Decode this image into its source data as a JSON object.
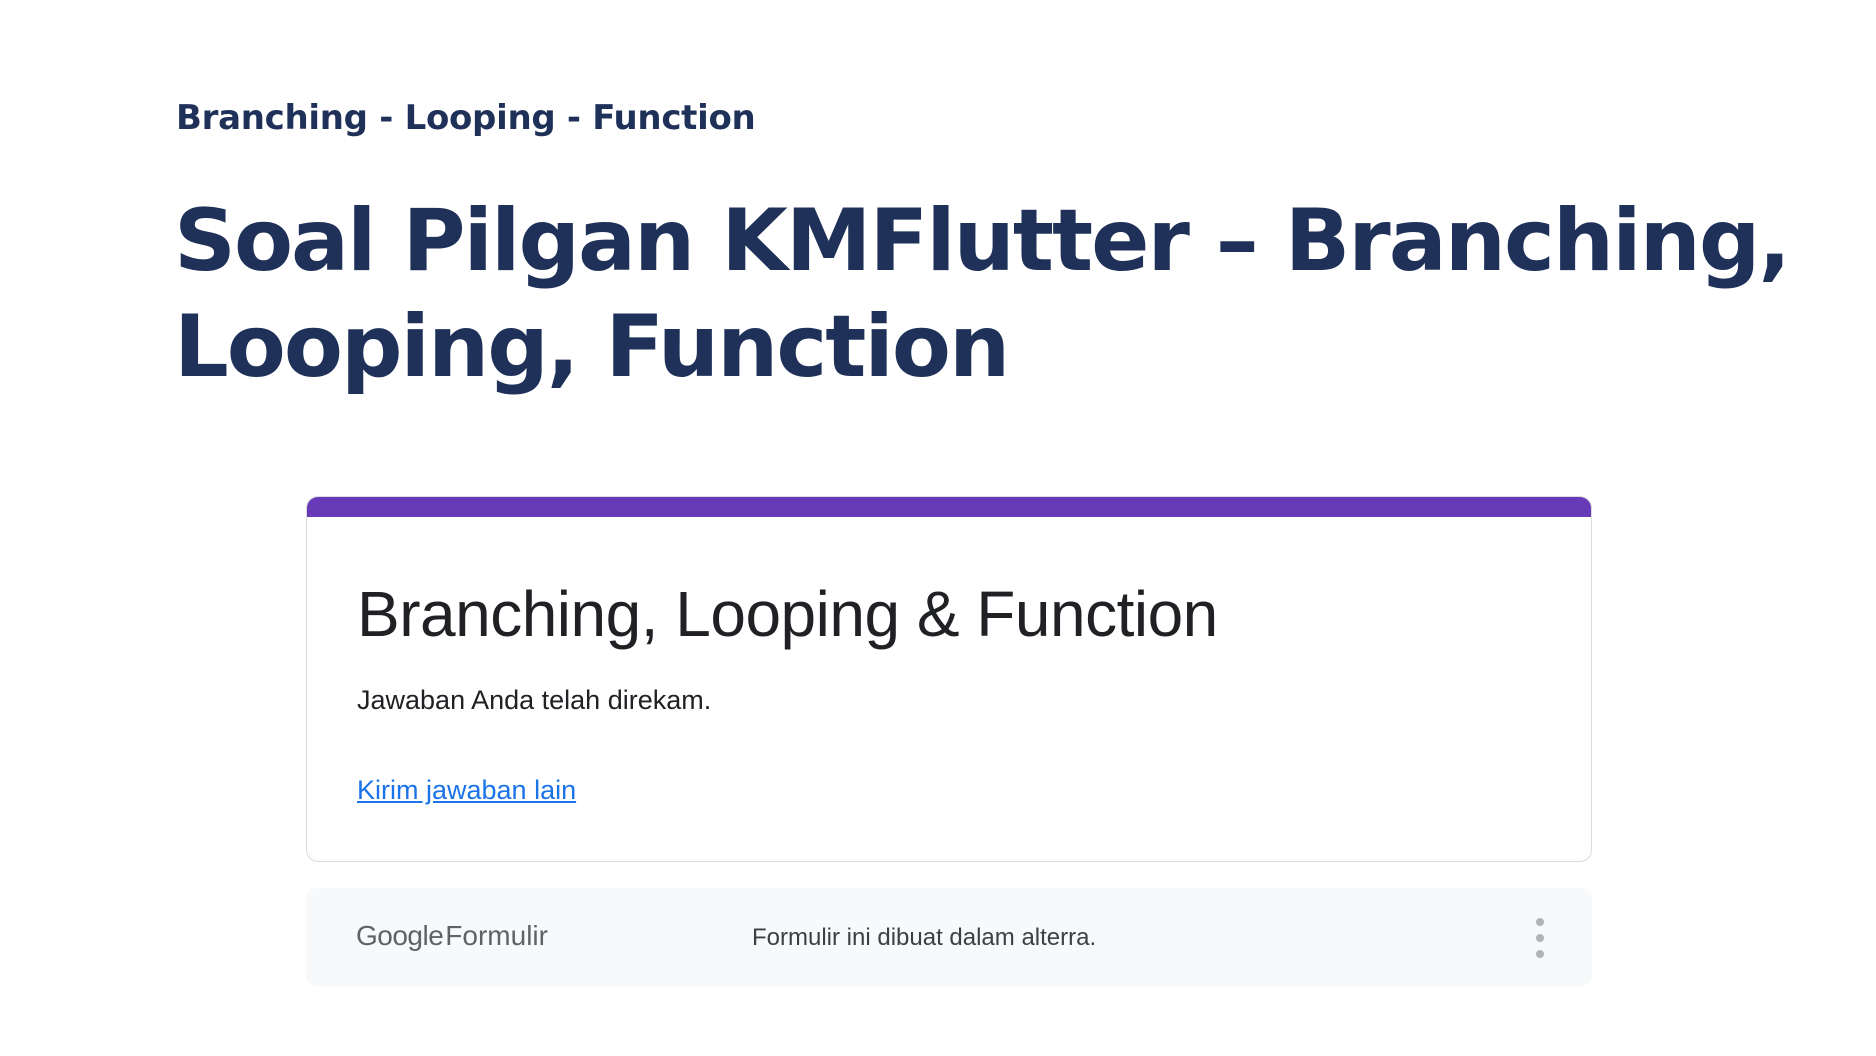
{
  "header": {
    "breadcrumb": "Branching - Looping - Function",
    "title": "Soal Pilgan KMFlutter – Branching, Looping, Function"
  },
  "form": {
    "accent_color": "#673ab7",
    "title": "Branching, Looping & Function",
    "message": "Jawaban Anda telah direkam.",
    "link_label": "Kirim jawaban lain"
  },
  "footer": {
    "logo_google": "Google",
    "logo_product": "Formulir",
    "note": "Formulir ini dibuat dalam alterra.",
    "menu_icon": "more-vert-icon"
  }
}
